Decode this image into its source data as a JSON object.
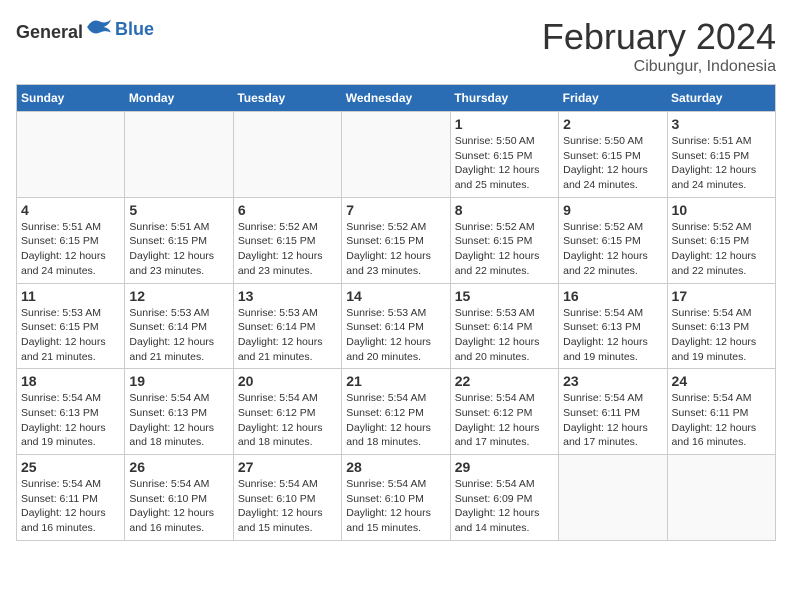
{
  "logo": {
    "general": "General",
    "blue": "Blue"
  },
  "title": "February 2024",
  "location": "Cibungur, Indonesia",
  "days_of_week": [
    "Sunday",
    "Monday",
    "Tuesday",
    "Wednesday",
    "Thursday",
    "Friday",
    "Saturday"
  ],
  "weeks": [
    [
      {
        "day": "",
        "info": ""
      },
      {
        "day": "",
        "info": ""
      },
      {
        "day": "",
        "info": ""
      },
      {
        "day": "",
        "info": ""
      },
      {
        "day": "1",
        "info": "Sunrise: 5:50 AM\nSunset: 6:15 PM\nDaylight: 12 hours\nand 25 minutes."
      },
      {
        "day": "2",
        "info": "Sunrise: 5:50 AM\nSunset: 6:15 PM\nDaylight: 12 hours\nand 24 minutes."
      },
      {
        "day": "3",
        "info": "Sunrise: 5:51 AM\nSunset: 6:15 PM\nDaylight: 12 hours\nand 24 minutes."
      }
    ],
    [
      {
        "day": "4",
        "info": "Sunrise: 5:51 AM\nSunset: 6:15 PM\nDaylight: 12 hours\nand 24 minutes."
      },
      {
        "day": "5",
        "info": "Sunrise: 5:51 AM\nSunset: 6:15 PM\nDaylight: 12 hours\nand 23 minutes."
      },
      {
        "day": "6",
        "info": "Sunrise: 5:52 AM\nSunset: 6:15 PM\nDaylight: 12 hours\nand 23 minutes."
      },
      {
        "day": "7",
        "info": "Sunrise: 5:52 AM\nSunset: 6:15 PM\nDaylight: 12 hours\nand 23 minutes."
      },
      {
        "day": "8",
        "info": "Sunrise: 5:52 AM\nSunset: 6:15 PM\nDaylight: 12 hours\nand 22 minutes."
      },
      {
        "day": "9",
        "info": "Sunrise: 5:52 AM\nSunset: 6:15 PM\nDaylight: 12 hours\nand 22 minutes."
      },
      {
        "day": "10",
        "info": "Sunrise: 5:52 AM\nSunset: 6:15 PM\nDaylight: 12 hours\nand 22 minutes."
      }
    ],
    [
      {
        "day": "11",
        "info": "Sunrise: 5:53 AM\nSunset: 6:15 PM\nDaylight: 12 hours\nand 21 minutes."
      },
      {
        "day": "12",
        "info": "Sunrise: 5:53 AM\nSunset: 6:14 PM\nDaylight: 12 hours\nand 21 minutes."
      },
      {
        "day": "13",
        "info": "Sunrise: 5:53 AM\nSunset: 6:14 PM\nDaylight: 12 hours\nand 21 minutes."
      },
      {
        "day": "14",
        "info": "Sunrise: 5:53 AM\nSunset: 6:14 PM\nDaylight: 12 hours\nand 20 minutes."
      },
      {
        "day": "15",
        "info": "Sunrise: 5:53 AM\nSunset: 6:14 PM\nDaylight: 12 hours\nand 20 minutes."
      },
      {
        "day": "16",
        "info": "Sunrise: 5:54 AM\nSunset: 6:13 PM\nDaylight: 12 hours\nand 19 minutes."
      },
      {
        "day": "17",
        "info": "Sunrise: 5:54 AM\nSunset: 6:13 PM\nDaylight: 12 hours\nand 19 minutes."
      }
    ],
    [
      {
        "day": "18",
        "info": "Sunrise: 5:54 AM\nSunset: 6:13 PM\nDaylight: 12 hours\nand 19 minutes."
      },
      {
        "day": "19",
        "info": "Sunrise: 5:54 AM\nSunset: 6:13 PM\nDaylight: 12 hours\nand 18 minutes."
      },
      {
        "day": "20",
        "info": "Sunrise: 5:54 AM\nSunset: 6:12 PM\nDaylight: 12 hours\nand 18 minutes."
      },
      {
        "day": "21",
        "info": "Sunrise: 5:54 AM\nSunset: 6:12 PM\nDaylight: 12 hours\nand 18 minutes."
      },
      {
        "day": "22",
        "info": "Sunrise: 5:54 AM\nSunset: 6:12 PM\nDaylight: 12 hours\nand 17 minutes."
      },
      {
        "day": "23",
        "info": "Sunrise: 5:54 AM\nSunset: 6:11 PM\nDaylight: 12 hours\nand 17 minutes."
      },
      {
        "day": "24",
        "info": "Sunrise: 5:54 AM\nSunset: 6:11 PM\nDaylight: 12 hours\nand 16 minutes."
      }
    ],
    [
      {
        "day": "25",
        "info": "Sunrise: 5:54 AM\nSunset: 6:11 PM\nDaylight: 12 hours\nand 16 minutes."
      },
      {
        "day": "26",
        "info": "Sunrise: 5:54 AM\nSunset: 6:10 PM\nDaylight: 12 hours\nand 16 minutes."
      },
      {
        "day": "27",
        "info": "Sunrise: 5:54 AM\nSunset: 6:10 PM\nDaylight: 12 hours\nand 15 minutes."
      },
      {
        "day": "28",
        "info": "Sunrise: 5:54 AM\nSunset: 6:10 PM\nDaylight: 12 hours\nand 15 minutes."
      },
      {
        "day": "29",
        "info": "Sunrise: 5:54 AM\nSunset: 6:09 PM\nDaylight: 12 hours\nand 14 minutes."
      },
      {
        "day": "",
        "info": ""
      },
      {
        "day": "",
        "info": ""
      }
    ]
  ]
}
